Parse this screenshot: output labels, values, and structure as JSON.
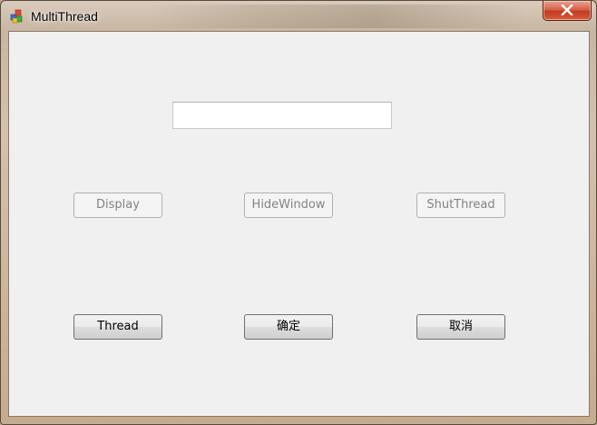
{
  "window": {
    "title": "MultiThread",
    "close_symbol": "✕"
  },
  "input": {
    "value": "",
    "placeholder": ""
  },
  "buttons": {
    "display": "Display",
    "hide_window": "HideWindow",
    "shut_thread": "ShutThread",
    "thread": "Thread",
    "ok": "确定",
    "cancel": "取消"
  },
  "state": {
    "display_enabled": false,
    "hide_window_enabled": false,
    "shut_thread_enabled": false
  },
  "icons": {
    "app": "mfc-app-icon",
    "close": "close-icon"
  }
}
